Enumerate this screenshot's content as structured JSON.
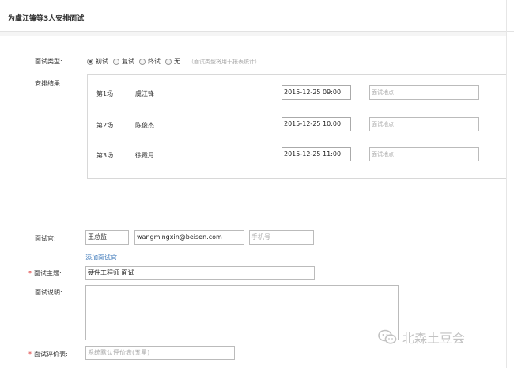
{
  "dialog": {
    "title": "为虞江锋等3人安排面试"
  },
  "interview_type": {
    "label": "面试类型:",
    "options": [
      {
        "label": "初试",
        "selected": true
      },
      {
        "label": "复试",
        "selected": false
      },
      {
        "label": "终试",
        "selected": false
      },
      {
        "label": "无",
        "selected": false
      }
    ],
    "hint": "（面试类型将用于报表统计）"
  },
  "schedule": {
    "label": "安排结果",
    "rows": [
      {
        "round": "第1场",
        "name": "虞江锋",
        "time": "2015-12-25 09:00",
        "place_placeholder": "面试地点"
      },
      {
        "round": "第2场",
        "name": "陈俊杰",
        "time": "2015-12-25 10:00",
        "place_placeholder": "面试地点"
      },
      {
        "round": "第3场",
        "name": "徐霞月",
        "time": "2015-12-25 11:00",
        "place_placeholder": "面试地点"
      }
    ]
  },
  "interviewer": {
    "label": "面试官:",
    "name": "王总监",
    "email": "wangmingxin@beisen.com",
    "phone_placeholder": "手机号",
    "add_link": "添加面试官"
  },
  "subject": {
    "required_mark": "*",
    "label": "面试主题:",
    "value": "硬件工程师 面试"
  },
  "description": {
    "label": "面试说明:"
  },
  "evaluation": {
    "required_mark": "*",
    "label": "面试评价表:",
    "placeholder": "系统默认评价表(五星)"
  },
  "watermark": {
    "text": "北森土豆会",
    "icon": "wechat-icon"
  }
}
